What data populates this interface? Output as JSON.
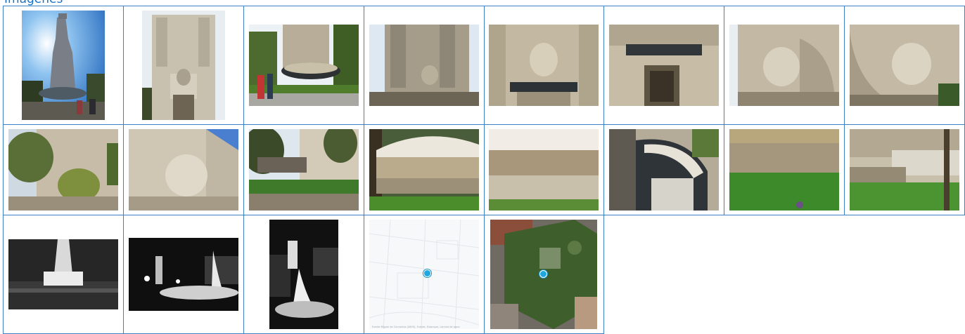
{
  "section": {
    "title": "Imágenes"
  },
  "map": {
    "caption": "Fuente Miguel de Cervantes (0605), Fuente, Estanque, Lámina de agua",
    "accent": "#1ea7e1"
  },
  "rows": [
    [
      {
        "name": "thumb-monument-tower-backlit",
        "icon": "photo-icon"
      },
      {
        "name": "thumb-monument-front-statue",
        "icon": "photo-icon"
      },
      {
        "name": "thumb-monument-fountain-people",
        "icon": "photo-icon"
      },
      {
        "name": "thumb-monument-base-statue",
        "icon": "photo-icon"
      },
      {
        "name": "thumb-seated-figure-fountain",
        "icon": "photo-icon"
      },
      {
        "name": "thumb-fountain-niche",
        "icon": "photo-icon"
      },
      {
        "name": "thumb-reclining-statue-left",
        "icon": "photo-icon"
      },
      {
        "name": "thumb-reclining-statue-right",
        "icon": "photo-icon"
      }
    ],
    [
      {
        "name": "thumb-statue-trees",
        "icon": "photo-icon"
      },
      {
        "name": "thumb-statue-closeup",
        "icon": "photo-icon"
      },
      {
        "name": "thumb-fountain-garden",
        "icon": "photo-icon"
      },
      {
        "name": "thumb-fountain-cascade",
        "icon": "photo-icon"
      },
      {
        "name": "thumb-fountain-basin-water",
        "icon": "photo-icon"
      },
      {
        "name": "thumb-fountain-shells",
        "icon": "photo-icon"
      },
      {
        "name": "thumb-fountain-lawn",
        "icon": "photo-icon"
      },
      {
        "name": "thumb-monument-steps-lawn",
        "icon": "photo-icon"
      }
    ],
    [
      {
        "name": "thumb-historic-bw-crowd",
        "icon": "photo-icon"
      },
      {
        "name": "thumb-night-fountain-wide",
        "icon": "photo-icon"
      },
      {
        "name": "thumb-night-fountain-tall",
        "icon": "photo-icon"
      },
      {
        "name": "thumb-street-map",
        "icon": "map-icon"
      },
      {
        "name": "thumb-satellite-map",
        "icon": "satellite-icon"
      }
    ]
  ]
}
